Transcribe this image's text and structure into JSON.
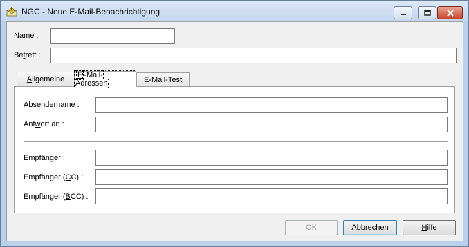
{
  "window": {
    "title": "NGC - Neue E-Mail-Benachrichtigung",
    "icon": "warning-envelope-icon"
  },
  "header_fields": {
    "name": {
      "label_prefix": "",
      "label_ul": "N",
      "label_rest": "ame :",
      "value": ""
    },
    "betreff": {
      "label_prefix": "Be",
      "label_ul": "t",
      "label_rest": "reff :",
      "value": ""
    }
  },
  "tabs": {
    "allgemeine": {
      "pre": "",
      "ul": "A",
      "post": "llgemeine"
    },
    "email_adressen": {
      "pre": "",
      "ul": "E",
      "post": "-Mail-Adressen"
    },
    "email_test": {
      "pre": "E-Mail-",
      "ul": "T",
      "post": "est"
    }
  },
  "address_fields": {
    "absender": {
      "pre": "Absen",
      "ul": "d",
      "post": "ername :",
      "value": ""
    },
    "antwort": {
      "pre": "Ant",
      "ul": "w",
      "post": "ort an :",
      "value": ""
    },
    "empfaenger": {
      "pre": "Emp",
      "ul": "f",
      "post": "änger :",
      "value": ""
    },
    "empfaenger_cc": {
      "pre": "Empfänger (",
      "ul": "C",
      "post": "C) :",
      "value": ""
    },
    "empfaenger_bcc": {
      "pre": "Empfänger (",
      "ul": "B",
      "post": "CC) :",
      "value": ""
    }
  },
  "buttons": {
    "ok": "OK",
    "abbrechen": "Abbrechen",
    "hilfe": {
      "pre": "",
      "ul": "H",
      "post": "ilfe"
    }
  }
}
